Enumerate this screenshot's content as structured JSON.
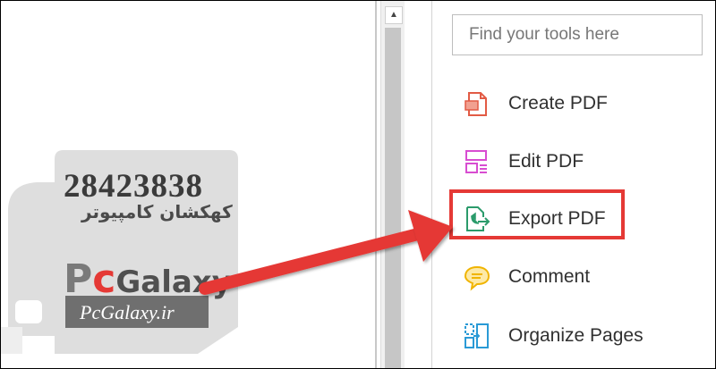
{
  "scrollbar": {
    "up_arrow": "▲"
  },
  "search": {
    "placeholder": "Find your tools here",
    "value": ""
  },
  "tools": [
    {
      "label": "Create PDF",
      "icon": "create-pdf-icon",
      "color": "#e25b45"
    },
    {
      "label": "Edit PDF",
      "icon": "edit-pdf-icon",
      "color": "#d84dd1"
    },
    {
      "label": "Export PDF",
      "icon": "export-pdf-icon",
      "color": "#2b9b6b"
    },
    {
      "label": "Comment",
      "icon": "comment-icon",
      "color": "#f0b400"
    },
    {
      "label": "Organize Pages",
      "icon": "organize-pages-icon",
      "color": "#2a9ad6"
    }
  ],
  "highlight": {
    "color": "#e53935",
    "target": "Export PDF"
  },
  "watermark": {
    "phone": "28423838",
    "persian": "کهکشان کامپیوتر",
    "brand_p": "P",
    "brand_c": "c",
    "brand_rest": "Galaxy",
    "site": "PcGalaxy.ir"
  }
}
